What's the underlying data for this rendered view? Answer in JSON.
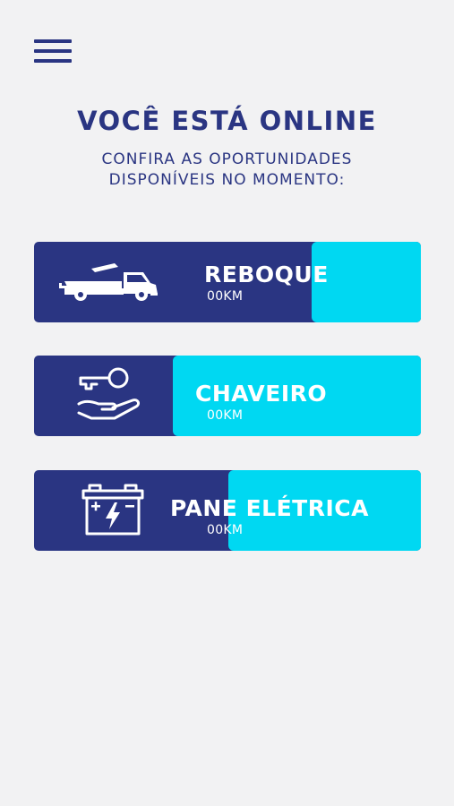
{
  "header": {
    "menu_icon": "hamburger-menu-icon",
    "title": "VOCÊ ESTÁ ONLINE",
    "subtitle_line1": "CONFIRA AS OPORTUNIDADES",
    "subtitle_line2": "DISPONÍVEIS NO MOMENTO:"
  },
  "services": [
    {
      "label": "REBOQUE",
      "distance": "00KM",
      "icon": "tow-truck-icon"
    },
    {
      "label": "CHAVEIRO",
      "distance": "00KM",
      "icon": "key-hand-icon"
    },
    {
      "label": "PANE ELÉTRICA",
      "distance": "00KM",
      "icon": "car-battery-icon"
    }
  ],
  "colors": {
    "background": "#f2f2f3",
    "primary": "#2a3582",
    "accent": "#00d8f2",
    "text_on_card": "#ffffff"
  }
}
